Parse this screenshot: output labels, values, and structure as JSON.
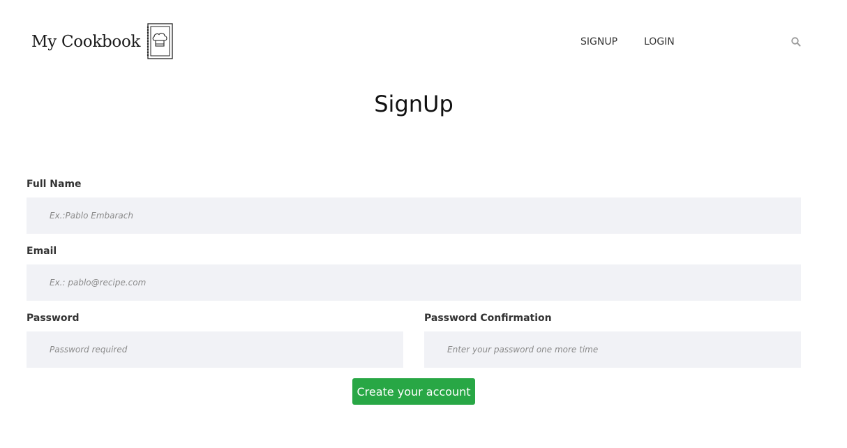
{
  "header": {
    "brand": "My Cookbook",
    "nav": {
      "signup": "SIGNUP",
      "login": "LOGIN"
    }
  },
  "page": {
    "title": "SignUp"
  },
  "form": {
    "full_name": {
      "label": "Full Name",
      "value": "",
      "placeholder": "Ex.:Pablo Embarach"
    },
    "email": {
      "label": "Email",
      "value": "",
      "placeholder": "Ex.: pablo@recipe.com"
    },
    "password": {
      "label": "Password",
      "value": "",
      "placeholder": "Password required"
    },
    "password_confirmation": {
      "label": "Password Confirmation",
      "value": "",
      "placeholder": "Enter your password one more time"
    },
    "submit_label": "Create your account"
  },
  "colors": {
    "primary": "#28a745",
    "input_background": "#f1f2f6",
    "text": "#333333"
  },
  "icons": {
    "logo": "chef-book-icon",
    "search": "search-icon"
  }
}
